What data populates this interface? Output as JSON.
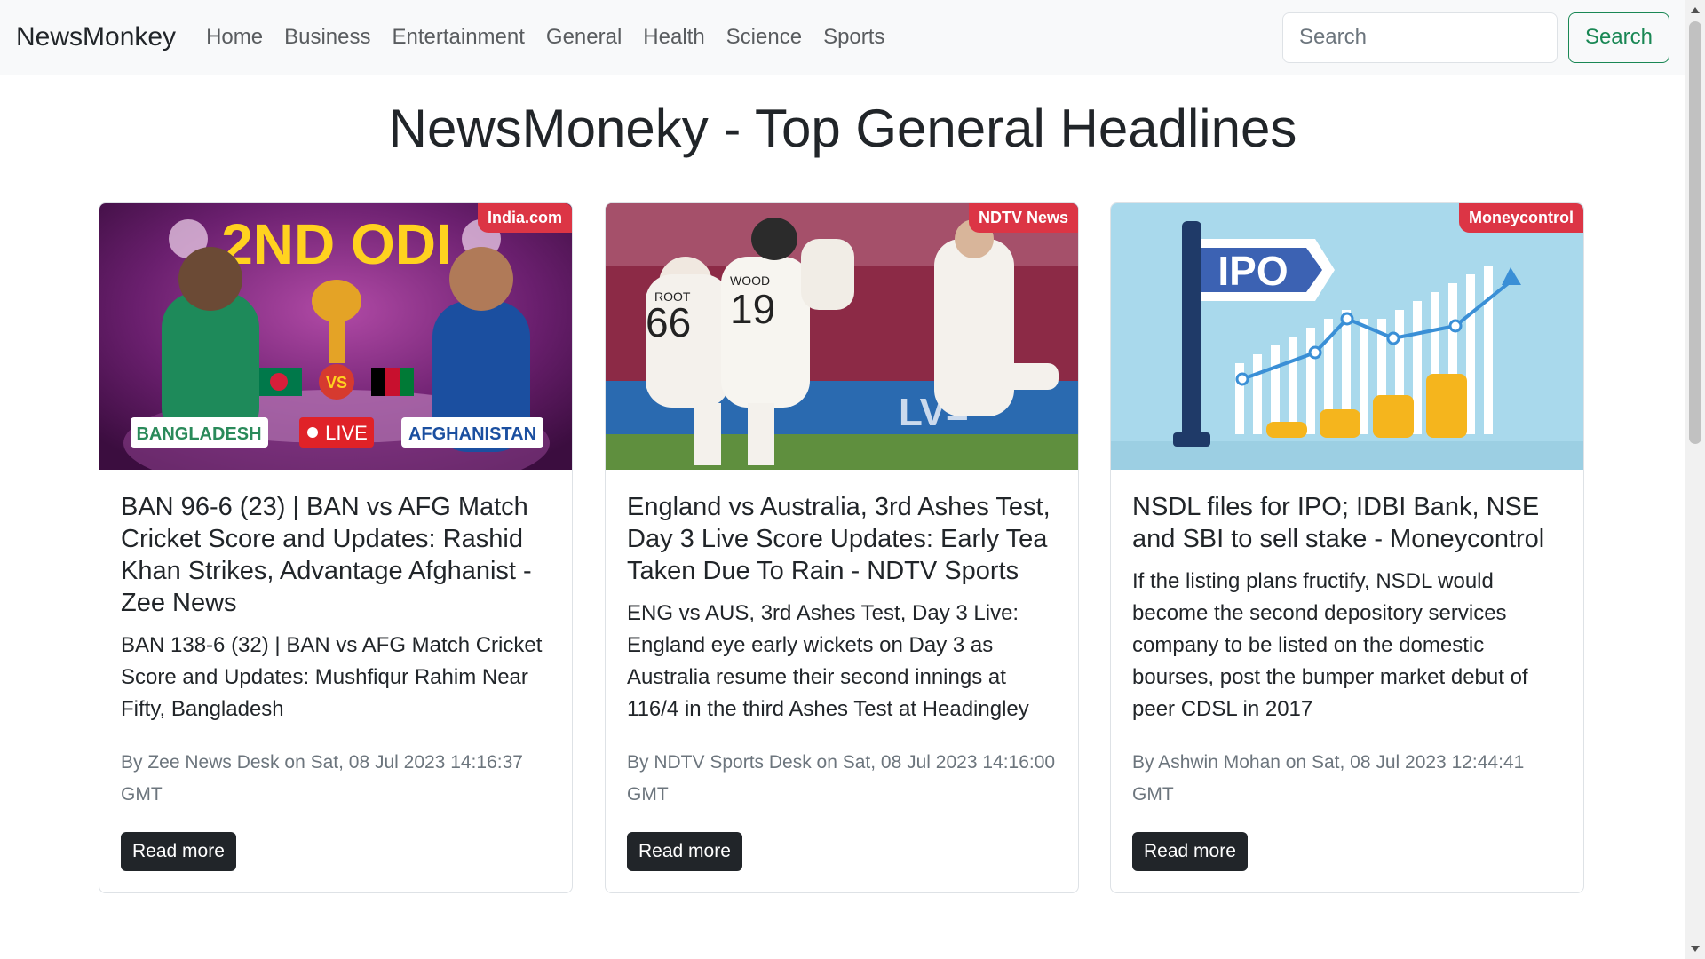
{
  "navbar": {
    "brand": "NewsMonkey",
    "links": [
      "Home",
      "Business",
      "Entertainment",
      "General",
      "Health",
      "Science",
      "Sports"
    ],
    "search_placeholder": "Search",
    "search_button": "Search"
  },
  "page": {
    "title": "NewsMoneky - Top General Headlines"
  },
  "cards": [
    {
      "source": "India.com",
      "image": {
        "headline": "2ND ODI",
        "team_left": "BANGLADESH",
        "team_right": "AFGHANISTAN",
        "live": "LIVE",
        "vs": "VS"
      },
      "title": "BAN 96-6 (23) | BAN vs AFG Match Cricket Score and Updates: Rashid Khan Strikes, Advantage Afghanist - Zee News",
      "description": "BAN 138-6 (32) | BAN vs AFG Match Cricket Score and Updates: Mushfiqur Rahim Near Fifty, Bangladesh",
      "meta": "By Zee News Desk on Sat, 08 Jul 2023 14:16:37 GMT",
      "button": "Read more"
    },
    {
      "source": "NDTV News",
      "image": {
        "jersey_1": "66",
        "jersey_2": "19",
        "jersey_name_1": "ROOT",
        "jersey_name_2": "WOOD",
        "hoarding": "LV="
      },
      "title": "England vs Australia, 3rd Ashes Test, Day 3 Live Score Updates: Early Tea Taken Due To Rain - NDTV Sports",
      "description": "ENG vs AUS, 3rd Ashes Test, Day 3 Live: England eye early wickets on Day 3 as Australia resume their second innings at 116/4 in the third Ashes Test at Headingley",
      "meta": "By NDTV Sports Desk on Sat, 08 Jul 2023 14:16:00 GMT",
      "button": "Read more"
    },
    {
      "source": "Moneycontrol",
      "image": {
        "flag_text": "IPO"
      },
      "title": "NSDL files for IPO; IDBI Bank, NSE and SBI to sell stake - Moneycontrol",
      "description": "If the listing plans fructify, NSDL would become the second depository services company to be listed on the domestic bourses, post the bumper market debut of peer CDSL in 2017",
      "meta": "By Ashwin Mohan on Sat, 08 Jul 2023 12:44:41 GMT",
      "button": "Read more"
    }
  ],
  "colors": {
    "navbar_bg": "#f8f9fa",
    "badge_red": "#dc3545",
    "search_green": "#198754",
    "button_dark": "#212529"
  }
}
